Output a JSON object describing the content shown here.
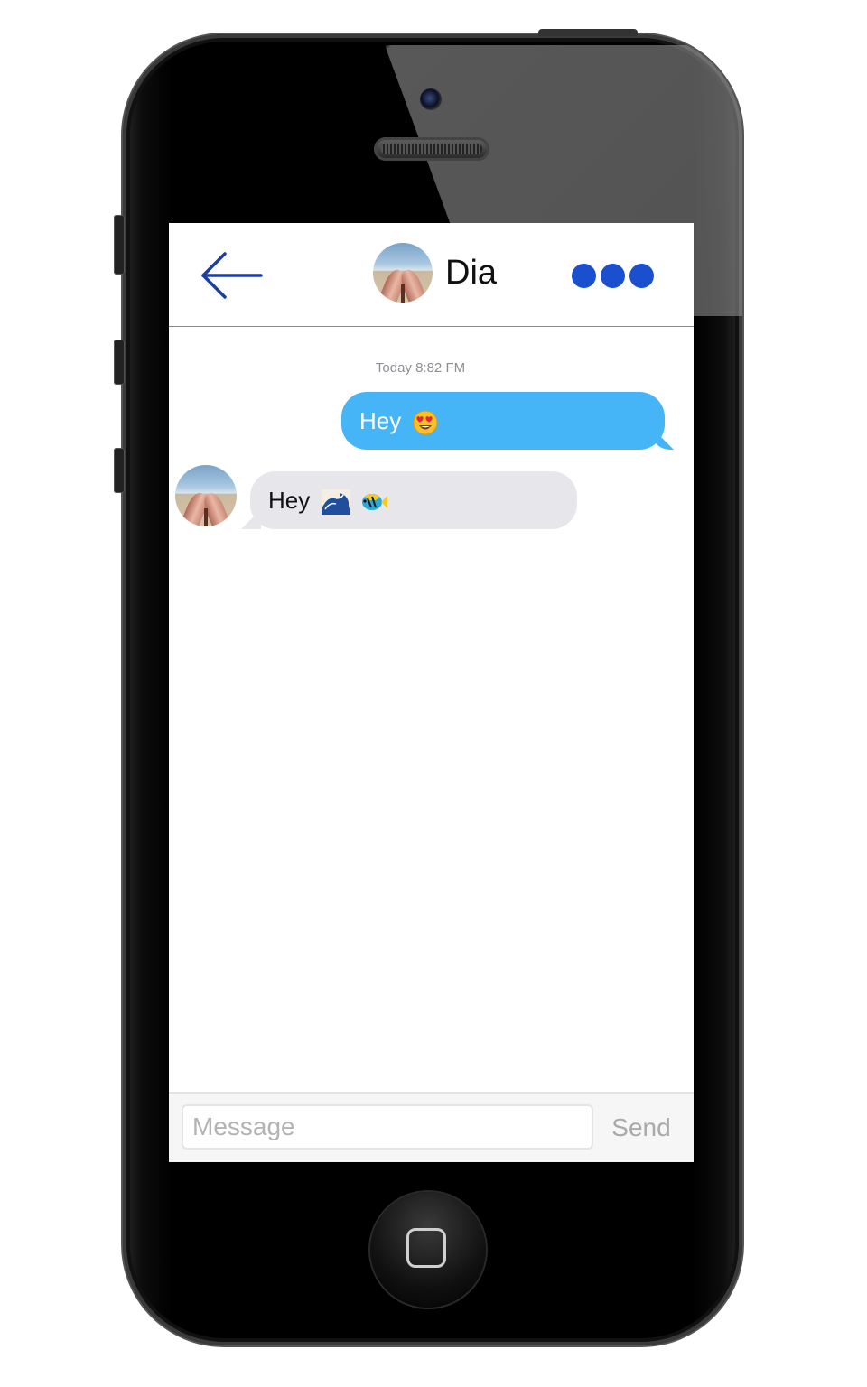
{
  "header": {
    "back_icon": "arrow-left-icon",
    "contact_name": "Dia",
    "more_icon": "more-dots-icon",
    "accent_color": "#1a4fd0"
  },
  "conversation": {
    "timestamp": "Today 8:82 FM",
    "messages": [
      {
        "direction": "outgoing",
        "text": "Hey",
        "emoji": [
          "heart-eyes-emoji"
        ],
        "bubble_color": "#45b5f8"
      },
      {
        "direction": "incoming",
        "text": "Hey",
        "emoji": [
          "wave-emoji",
          "tropical-fish-emoji"
        ],
        "bubble_color": "#e6e6eb"
      }
    ]
  },
  "composer": {
    "placeholder": "Message",
    "value": "",
    "send_label": "Send"
  }
}
